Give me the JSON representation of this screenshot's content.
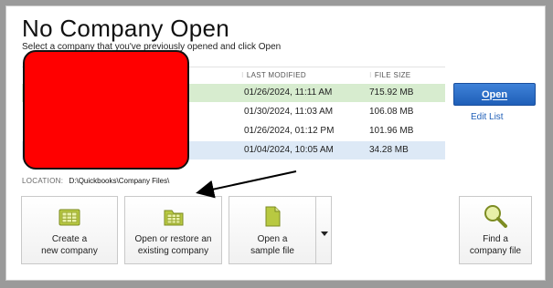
{
  "dialog": {
    "title": "No Company Open",
    "subtitle": "Select a company that you've previously opened and click Open"
  },
  "list": {
    "columns": {
      "last_modified": "LAST MODIFIED",
      "file_size": "FILE SIZE"
    },
    "rows": [
      {
        "name": "",
        "modified": "01/26/2024, 11:11 AM",
        "size": "715.92 MB"
      },
      {
        "name": "",
        "modified": "01/30/2024, 11:03 AM",
        "size": "106.08 MB"
      },
      {
        "name": "",
        "modified": "01/26/2024, 01:12 PM",
        "size": "101.96 MB"
      },
      {
        "name": "",
        "modified": "01/04/2024, 10:05 AM",
        "size": "34.28 MB"
      },
      {
        "name": "",
        "modified": "",
        "size": ""
      }
    ]
  },
  "buttons": {
    "open": "Open",
    "edit_list": "Edit List"
  },
  "location": {
    "label": "LOCATION:",
    "value": "D:\\Quickbooks\\Company Files\\"
  },
  "actions": {
    "create": [
      "Create a",
      "new company"
    ],
    "open_restore": [
      "Open or restore an",
      "existing company"
    ],
    "sample": [
      "Open a",
      "sample file"
    ],
    "find": [
      "Find a",
      "company file"
    ]
  },
  "colors": {
    "selected_row": "#d7eccf",
    "alt_row": "#dde9f6",
    "open_button": "#2a6fc9",
    "redaction": "#ff0000",
    "annotation_arrow": "#000000"
  },
  "icons": {
    "create": "new-company-icon",
    "open_restore": "open-restore-icon",
    "sample": "sample-file-icon",
    "find": "magnifier-icon"
  }
}
